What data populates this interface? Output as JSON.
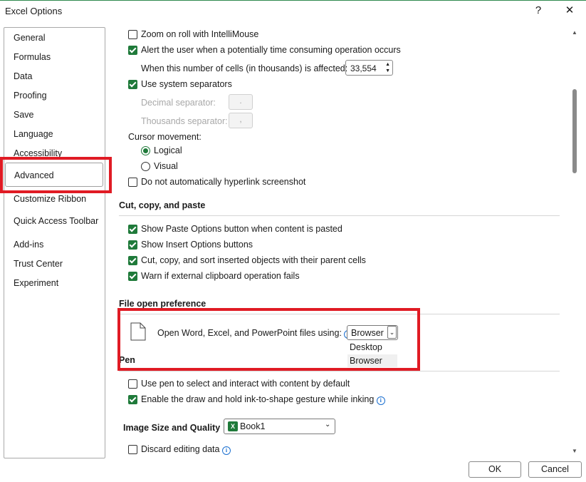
{
  "window": {
    "title": "Excel Options",
    "help_label": "?",
    "close_label": "✕"
  },
  "nav": {
    "items": [
      "General",
      "Formulas",
      "Data",
      "Proofing",
      "Save",
      "Language",
      "Accessibility"
    ],
    "selected": "Advanced",
    "items_after": [
      "Customize Ribbon",
      "Quick Access Toolbar",
      "Add-ins",
      "Trust Center",
      "Experiment"
    ]
  },
  "editing": {
    "zoom_roll": {
      "label": "Zoom on roll with IntelliMouse",
      "checked": false
    },
    "alert_time": {
      "label": "Alert the user when a potentially time consuming operation occurs",
      "checked": true
    },
    "cells_label": "When this number of cells (in thousands) is affected:",
    "cells_value": "33,554",
    "system_sep": {
      "label": "Use system separators",
      "checked": true
    },
    "decimal_label": "Decimal separator:",
    "decimal_value": ".",
    "thousands_label": "Thousands separator:",
    "thousands_value": ",",
    "cursor_label": "Cursor movement:",
    "cursor_logical": "Logical",
    "cursor_visual": "Visual",
    "no_hyperlink": {
      "label": "Do not automatically hyperlink screenshot",
      "checked": false
    }
  },
  "cut_copy": {
    "heading": "Cut, copy, and paste",
    "items": [
      {
        "label": "Show Paste Options button when content is pasted",
        "checked": true
      },
      {
        "label": "Show Insert Options buttons",
        "checked": true
      },
      {
        "label": "Cut, copy, and sort inserted objects with their parent cells",
        "checked": true
      },
      {
        "label": "Warn if external clipboard operation fails",
        "checked": true
      }
    ]
  },
  "file_open": {
    "heading": "File open preference",
    "label": "Open Word, Excel, and PowerPoint files using:",
    "selected": "Browser",
    "options": [
      "Desktop",
      "Browser"
    ]
  },
  "pen": {
    "heading": "Pen",
    "items": [
      {
        "label": "Use pen to select and interact with content by default",
        "checked": false
      },
      {
        "label": "Enable the draw and hold ink-to-shape gesture while inking",
        "checked": true
      }
    ]
  },
  "image_size": {
    "heading": "Image Size and Quality",
    "workbook": "Book1",
    "discard": {
      "label": "Discard editing data",
      "checked": false
    }
  },
  "buttons": {
    "ok": "OK",
    "cancel": "Cancel"
  },
  "colors": {
    "accent": "#1f7a3a",
    "highlight_box": "#e01b24",
    "info": "#1a6fd0"
  }
}
